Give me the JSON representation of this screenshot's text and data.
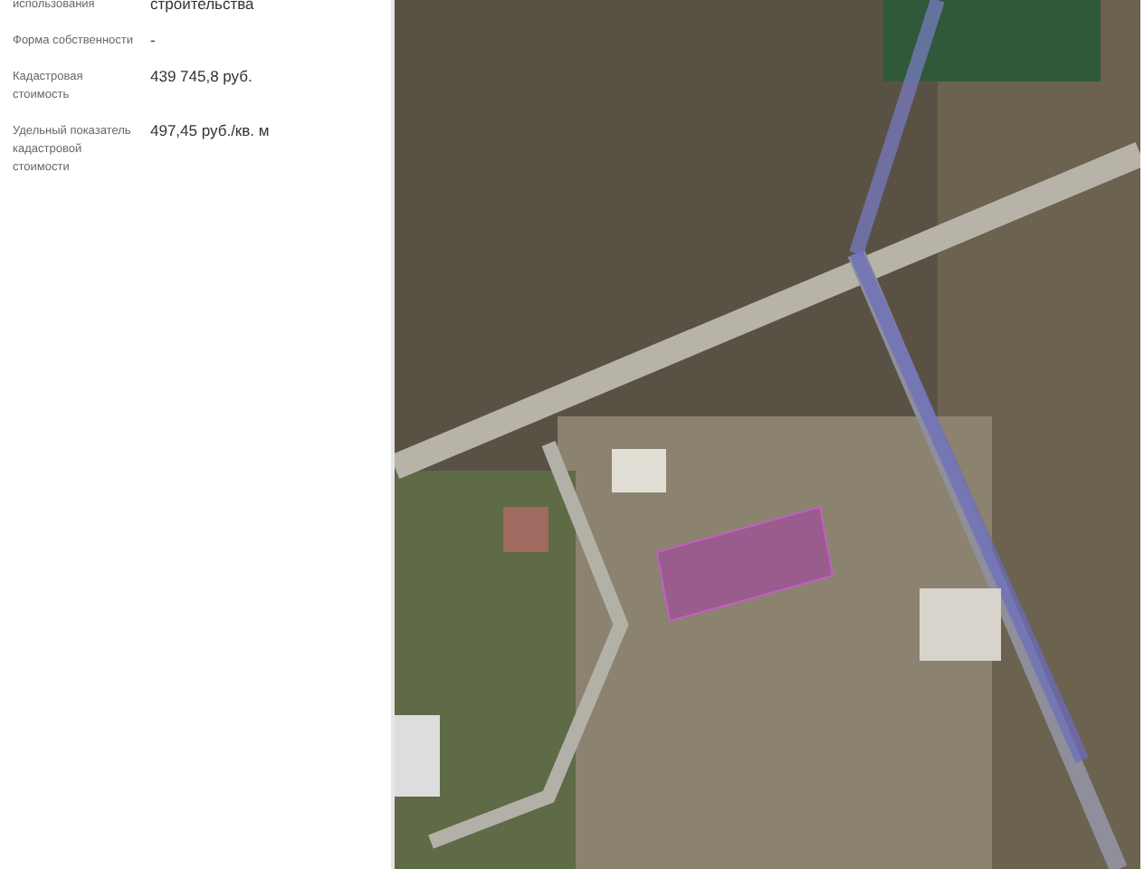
{
  "properties": [
    {
      "label": "использования",
      "value": "строительства"
    },
    {
      "label": "Форма собственности",
      "value": "-"
    },
    {
      "label": "Кадастровая стоимость",
      "value": "439 745,8 руб."
    },
    {
      "label": "Удельный показатель кадастровой стоимости",
      "value": "497,45 руб./кв. м"
    }
  ]
}
